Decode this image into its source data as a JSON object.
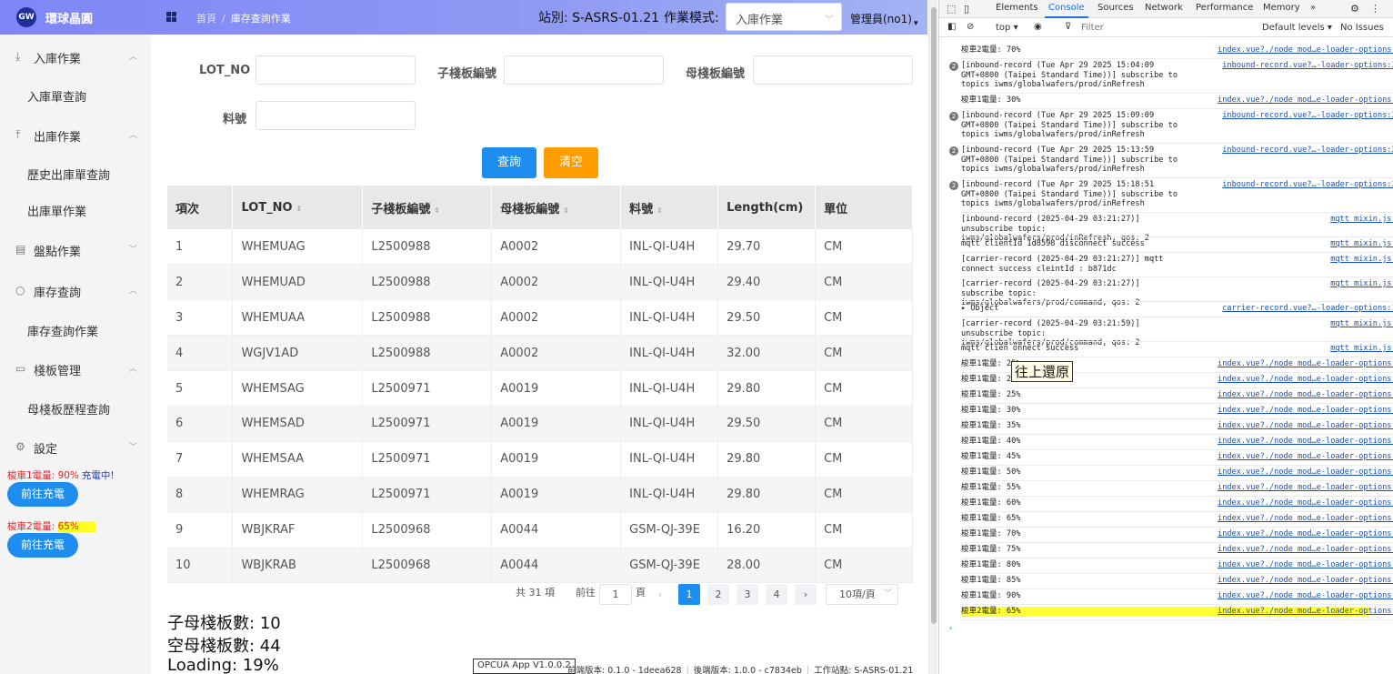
{
  "header": {
    "logo_text": "GW",
    "brand": "環球晶圓",
    "breadcrumb": [
      "首頁",
      "庫存查詢作業"
    ],
    "station": "站別:  S-ASRS-01.21",
    "mode_label": "作業模式:",
    "mode_value": "入庫作業",
    "user": "管理員(no1)"
  },
  "sidebar": {
    "groups": [
      {
        "icon": "download-icon",
        "glyph": "⤓",
        "label": "入庫作業",
        "arrow": "︿"
      },
      {
        "icon": "upload-icon",
        "glyph": "⤒",
        "label": "出庫作業",
        "arrow": "︿"
      },
      {
        "icon": "document-icon",
        "glyph": "▤",
        "label": "盤點作業",
        "arrow": "﹀"
      },
      {
        "icon": "search-icon",
        "glyph": "○",
        "label": "庫存查詢",
        "arrow": "︿"
      },
      {
        "icon": "board-icon",
        "glyph": "▭",
        "label": "棧板管理",
        "arrow": "︿"
      },
      {
        "icon": "gear-icon",
        "glyph": "⚙",
        "label": "設定",
        "arrow": "﹀"
      }
    ],
    "subs": [
      "入庫單查詢",
      "歷史出庫單查詢",
      "出庫單作業",
      "庫存查詢作業",
      "母棧板歷程查詢"
    ],
    "battery1_label": "梭車1電量:",
    "battery1_value": "90%",
    "battery1_status": "充電中!",
    "battery2_label": "梭車2電量:",
    "battery2_value": "65%",
    "charge_button": "前往充電"
  },
  "form": {
    "lot_label": "LOT_NO",
    "child_label": "子棧板編號",
    "parent_label": "母棧板編號",
    "part_label": "料號",
    "query_button": "查詢",
    "clear_button": "清空"
  },
  "table": {
    "headers": [
      "項次",
      "LOT_NO",
      "子棧板編號",
      "母棧板編號",
      "料號",
      "Length(cm)",
      "單位"
    ],
    "sort_glyph": "⇕",
    "rows": [
      [
        "1",
        "WHEMUAG",
        "L2500988",
        "A0002",
        "INL-QI-U4H",
        "29.70",
        "CM"
      ],
      [
        "2",
        "WHEMUAD",
        "L2500988",
        "A0002",
        "INL-QI-U4H",
        "29.40",
        "CM"
      ],
      [
        "3",
        "WHEMUAA",
        "L2500988",
        "A0002",
        "INL-QI-U4H",
        "29.50",
        "CM"
      ],
      [
        "4",
        "WGJV1AD",
        "L2500988",
        "A0002",
        "INL-QI-U4H",
        "32.00",
        "CM"
      ],
      [
        "5",
        "WHEMSAG",
        "L2500971",
        "A0019",
        "INL-QI-U4H",
        "29.80",
        "CM"
      ],
      [
        "6",
        "WHEMSAD",
        "L2500971",
        "A0019",
        "INL-QI-U4H",
        "29.50",
        "CM"
      ],
      [
        "7",
        "WHEMSAA",
        "L2500971",
        "A0019",
        "INL-QI-U4H",
        "29.80",
        "CM"
      ],
      [
        "8",
        "WHEMRAG",
        "L2500971",
        "A0019",
        "INL-QI-U4H",
        "29.80",
        "CM"
      ],
      [
        "9",
        "WBJKRAF",
        "L2500968",
        "A0044",
        "GSM-QJ-39E",
        "16.20",
        "CM"
      ],
      [
        "10",
        "WBJKRAB",
        "L2500968",
        "A0044",
        "GSM-QJ-39E",
        "28.00",
        "CM"
      ]
    ]
  },
  "pagination": {
    "total": "共 31 項",
    "goto_label": "前往",
    "goto_value": "1",
    "page_suffix": "頁",
    "prev": "‹",
    "next": "›",
    "pages": [
      "1",
      "2",
      "3",
      "4"
    ],
    "current_page": "1",
    "page_size": "10項/頁"
  },
  "stats": {
    "child_count": "子母棧板數:  10",
    "empty_count": "空母棧板數:  44",
    "loading": "Loading:  19%"
  },
  "footer": {
    "version_tag": "OPCUA App V1.0.0.2",
    "front": "前端版本:  0.1.0 - 1deea628",
    "back": "後端版本:  1.0.0 - c7834eb",
    "station": "工作站點:  S-ASRS-01.21"
  },
  "devtools": {
    "tabs": [
      "Elements",
      "Console",
      "Sources",
      "Network",
      "Performance",
      "Memory",
      "»"
    ],
    "active_tab": "Console",
    "context": "top ▾",
    "filter_placeholder": "Filter",
    "levels": "Default levels ▾",
    "issues": "No Issues",
    "tooltip": "往上還原",
    "logs": [
      {
        "text": "梭車2電量: 70%",
        "link": "index.vue?./node_mod…e-loader-options:89"
      },
      {
        "badge": "2",
        "text": "[inbound-record (Tue Apr 29 2025 15:04:09 GMT+0800 (Taipei Standard Time))] subscribe to topics iwms/globalwafers/prod/inRefresh",
        "link": "inbound-record.vue?…-loader-options:296"
      },
      {
        "text": "梭車1電量: 30%",
        "link": "index.vue?./node_mod…e-loader-options:83"
      },
      {
        "badge": "2",
        "text": "[inbound-record (Tue Apr 29 2025 15:09:09 GMT+0800 (Taipei Standard Time))] subscribe to topics iwms/globalwafers/prod/inRefresh",
        "link": "inbound-record.vue?…-loader-options:296"
      },
      {
        "badge": "2",
        "text": "[inbound-record (Tue Apr 29 2025 15:13:59 GMT+0800 (Taipei Standard Time))] subscribe to topics iwms/globalwafers/prod/inRefresh",
        "link": "inbound-record.vue?…-loader-options:296"
      },
      {
        "badge": "2",
        "text": "[inbound-record (Tue Apr 29 2025 15:18:51 GMT+0800 (Taipei Standard Time))] subscribe to topics iwms/globalwafers/prod/inRefresh",
        "link": "inbound-record.vue?…-loader-options:296"
      },
      {
        "text": "[inbound-record (2025-04-29 03:21:27)] unsubscribe topic: iwms/globalwafers/prod/inRefresh, qos: 2",
        "link": "mqtt_mixin.js:89"
      },
      {
        "text": "mqtt clientId 1d8598 disconnect success",
        "link": "mqtt_mixin.js:98"
      },
      {
        "text": "[carrier-record (2025-04-29 03:21:27)] mqtt connect success cleintId : b871dc",
        "link": "mqtt_mixin.js:44"
      },
      {
        "text": "[carrier-record (2025-04-29 03:21:27)] subscribe topic: iwms/globalwafers/prod/command, qos: 2",
        "link": "mqtt_mixin.js:63"
      },
      {
        "text": "▸ Object",
        "link": "carrier-record.vue?…-loader-options:110"
      },
      {
        "text": "[carrier-record (2025-04-29 03:21:59)] unsubscribe topic: iwms/globalwafers/prod/command, qos: 2",
        "link": "mqtt_mixin.js:89"
      },
      {
        "text": "mqtt clien          onnect success",
        "link": "mqtt_mixin.js:98"
      },
      {
        "text": "梭車1電量: 25%",
        "link": "index.vue?./node_mod…e-loader-options:83"
      },
      {
        "text": "梭車1電量: 20%",
        "link": "index.vue?./node_mod…e-loader-options:83"
      },
      {
        "text": "梭車1電量: 25%",
        "link": "index.vue?./node_mod…e-loader-options:83"
      },
      {
        "text": "梭車1電量: 30%",
        "link": "index.vue?./node_mod…e-loader-options:83"
      },
      {
        "text": "梭車1電量: 35%",
        "link": "index.vue?./node_mod…e-loader-options:83"
      },
      {
        "text": "梭車1電量: 40%",
        "link": "index.vue?./node_mod…e-loader-options:83"
      },
      {
        "text": "梭車1電量: 45%",
        "link": "index.vue?./node_mod…e-loader-options:83"
      },
      {
        "text": "梭車1電量: 50%",
        "link": "index.vue?./node_mod…e-loader-options:83"
      },
      {
        "text": "梭車1電量: 55%",
        "link": "index.vue?./node_mod…e-loader-options:83"
      },
      {
        "text": "梭車1電量: 60%",
        "link": "index.vue?./node_mod…e-loader-options:83"
      },
      {
        "text": "梭車1電量: 65%",
        "link": "index.vue?./node_mod…e-loader-options:83"
      },
      {
        "text": "梭車1電量: 70%",
        "link": "index.vue?./node_mod…e-loader-options:83"
      },
      {
        "text": "梭車1電量: 75%",
        "link": "index.vue?./node_mod…e-loader-options:83"
      },
      {
        "text": "梭車1電量: 80%",
        "link": "index.vue?./node_mod…e-loader-options:83"
      },
      {
        "text": "梭車1電量: 85%",
        "link": "index.vue?./node_mod…e-loader-options:83"
      },
      {
        "text": "梭車1電量: 90%",
        "link": "index.vue?./node_mod…e-loader-options:83"
      },
      {
        "text": "梭車2電量: 65%",
        "link": "index.vue?./node_mod…e-loader-options:89",
        "highlight": true
      }
    ],
    "prompt": "›"
  }
}
